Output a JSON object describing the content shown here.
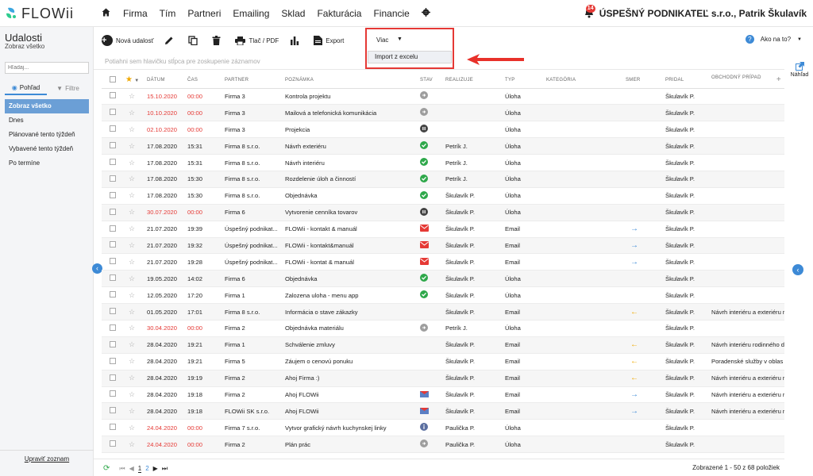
{
  "app": {
    "name": "FLOWii",
    "company": "ÚSPEŠNÝ PODNIKATEĽ s.r.o., Patrik Škulavík",
    "notifications": "14"
  },
  "nav": [
    "Firma",
    "Tím",
    "Partneri",
    "Emailing",
    "Sklad",
    "Fakturácia",
    "Financie"
  ],
  "sidebar": {
    "title": "Udalosti",
    "subtitle": "Zobraz všetko",
    "search_placeholder": "Hľadaj...",
    "tab_view": "Pohľad",
    "tab_filter": "Filtre",
    "items": [
      {
        "label": "Zobraz všetko",
        "active": true
      },
      {
        "label": "Dnes",
        "active": false
      },
      {
        "label": "Plánované tento týždeň",
        "active": false
      },
      {
        "label": "Vybavené tento týždeň",
        "active": false
      },
      {
        "label": "Po termíne",
        "active": false
      }
    ],
    "edit_list": "Upraviť zoznam"
  },
  "toolbar": {
    "new_event": "Nová udalosť",
    "print": "Tlač / PDF",
    "export": "Export",
    "more": "Viac",
    "import": "Import z excelu",
    "help": "Ako na to?",
    "preview": "Náhľad"
  },
  "group_hint": "Potiahni sem hlavičku stĺpca pre zoskupenie záznamov",
  "columns": [
    "DÁTUM",
    "ČAS",
    "PARTNER",
    "POZNÁMKA",
    "STAV",
    "REALIZUJE",
    "TYP",
    "KATEGÓRIA",
    "SMER",
    "PRIDAL",
    "OBCHODNÝ PRÍPAD"
  ],
  "rows": [
    {
      "date": "15.10.2020",
      "time": "00:00",
      "partner": "Firma 3",
      "note": "Kontrola projektu",
      "status": "pending",
      "assignee": "",
      "type": "Úloha",
      "direction": "",
      "added_by": "Škulavík P.",
      "case": "",
      "overdue": true
    },
    {
      "date": "10.10.2020",
      "time": "00:00",
      "partner": "Firma 3",
      "note": "Mailová a telefonická komunikácia",
      "status": "pending",
      "assignee": "",
      "type": "Úloha",
      "direction": "",
      "added_by": "Škulavík P.",
      "case": "",
      "overdue": true
    },
    {
      "date": "02.10.2020",
      "time": "00:00",
      "partner": "Firma 3",
      "note": "Projekcia",
      "status": "paused",
      "assignee": "",
      "type": "Úloha",
      "direction": "",
      "added_by": "Škulavík P.",
      "case": "",
      "overdue": true
    },
    {
      "date": "17.08.2020",
      "time": "15:31",
      "partner": "Firma 8 s.r.o.",
      "note": "Návrh exteriéru",
      "status": "done",
      "assignee": "Petrík J.",
      "type": "Úloha",
      "direction": "",
      "added_by": "Škulavík P.",
      "case": "",
      "overdue": false
    },
    {
      "date": "17.08.2020",
      "time": "15:31",
      "partner": "Firma 8 s.r.o.",
      "note": "Návrh interiéru",
      "status": "done",
      "assignee": "Petrík J.",
      "type": "Úloha",
      "direction": "",
      "added_by": "Škulavík P.",
      "case": "",
      "overdue": false
    },
    {
      "date": "17.08.2020",
      "time": "15:30",
      "partner": "Firma 8 s.r.o.",
      "note": "Rozdelenie úloh a činností",
      "status": "done",
      "assignee": "Petrík J.",
      "type": "Úloha",
      "direction": "",
      "added_by": "Škulavík P.",
      "case": "",
      "overdue": false
    },
    {
      "date": "17.08.2020",
      "time": "15:30",
      "partner": "Firma 8 s.r.o.",
      "note": "Objednávka",
      "status": "done",
      "assignee": "Škulavík P.",
      "type": "Úloha",
      "direction": "",
      "added_by": "Škulavík P.",
      "case": "",
      "overdue": false
    },
    {
      "date": "30.07.2020",
      "time": "00:00",
      "partner": "Firma 6",
      "note": "Vytvorenie cenníka tovarov",
      "status": "paused",
      "assignee": "Škulavík P.",
      "type": "Úloha",
      "direction": "",
      "added_by": "Škulavík P.",
      "case": "",
      "overdue": true
    },
    {
      "date": "21.07.2020",
      "time": "19:39",
      "partner": "Úspešný podnikat...",
      "note": "FLOWii - kontakt & manuál",
      "status": "email",
      "assignee": "Škulavík P.",
      "type": "Email",
      "direction": "out",
      "added_by": "Škulavík P.",
      "case": "",
      "overdue": false
    },
    {
      "date": "21.07.2020",
      "time": "19:32",
      "partner": "Úspešný podnikat...",
      "note": "FLOWii - kontakt&manuál",
      "status": "email",
      "assignee": "Škulavík P.",
      "type": "Email",
      "direction": "out",
      "added_by": "Škulavík P.",
      "case": "",
      "overdue": false
    },
    {
      "date": "21.07.2020",
      "time": "19:28",
      "partner": "Úspešný podnikat...",
      "note": "FLOWii - kontat & manuál",
      "status": "email",
      "assignee": "Škulavík P.",
      "type": "Email",
      "direction": "out",
      "added_by": "Škulavík P.",
      "case": "",
      "overdue": false
    },
    {
      "date": "19.05.2020",
      "time": "14:02",
      "partner": "Firma 6",
      "note": "Objednávka",
      "status": "done",
      "assignee": "Škulavík P.",
      "type": "Úloha",
      "direction": "",
      "added_by": "Škulavík P.",
      "case": "",
      "overdue": false
    },
    {
      "date": "12.05.2020",
      "time": "17:20",
      "partner": "Firma 1",
      "note": "Zalozena uloha - menu app",
      "status": "done",
      "assignee": "Škulavík P.",
      "type": "Úloha",
      "direction": "",
      "added_by": "Škulavík P.",
      "case": "",
      "overdue": false
    },
    {
      "date": "01.05.2020",
      "time": "17:01",
      "partner": "Firma 8 s.r.o.",
      "note": "Informácia o stave zákazky",
      "status": "",
      "assignee": "Škulavík P.",
      "type": "Email",
      "direction": "in",
      "added_by": "Škulavík P.",
      "case": "Návrh interiéru a exteriéru r",
      "overdue": false
    },
    {
      "date": "30.04.2020",
      "time": "00:00",
      "partner": "Firma 2",
      "note": "Objednávka materiálu",
      "status": "pending",
      "assignee": "Petrík J.",
      "type": "Úloha",
      "direction": "",
      "added_by": "Škulavík P.",
      "case": "",
      "overdue": true
    },
    {
      "date": "28.04.2020",
      "time": "19:21",
      "partner": "Firma 1",
      "note": "Schválenie zmluvy",
      "status": "",
      "assignee": "Škulavík P.",
      "type": "Email",
      "direction": "in",
      "added_by": "Škulavík P.",
      "case": "Návrh interiéru rodinného d",
      "overdue": false
    },
    {
      "date": "28.04.2020",
      "time": "19:21",
      "partner": "Firma 5",
      "note": "Záujem o cenovú ponuku",
      "status": "",
      "assignee": "Škulavík P.",
      "type": "Email",
      "direction": "in",
      "added_by": "Škulavík P.",
      "case": "Poradenské služby v oblas",
      "overdue": false
    },
    {
      "date": "28.04.2020",
      "time": "19:19",
      "partner": "Firma 2",
      "note": "Ahoj Firma :)",
      "status": "",
      "assignee": "Škulavík P.",
      "type": "Email",
      "direction": "in",
      "added_by": "Škulavík P.",
      "case": "Návrh interiéru a exteriéru r",
      "overdue": false
    },
    {
      "date": "28.04.2020",
      "time": "19:18",
      "partner": "Firma 2",
      "note": "Ahoj FLOWii",
      "status": "mail-open",
      "assignee": "Škulavík P.",
      "type": "Email",
      "direction": "out",
      "added_by": "Škulavík P.",
      "case": "Návrh interiéru a exteriéru r",
      "overdue": false
    },
    {
      "date": "28.04.2020",
      "time": "19:18",
      "partner": "FLOWii SK s.r.o.",
      "note": "Ahoj FLOWii",
      "status": "mail-open",
      "assignee": "Škulavík P.",
      "type": "Email",
      "direction": "out",
      "added_by": "Škulavík P.",
      "case": "Návrh interiéru a exteriéru r",
      "overdue": false
    },
    {
      "date": "24.04.2020",
      "time": "00:00",
      "partner": "Firma 7 s.r.o.",
      "note": "Vytvor grafický návrh kuchynskej linky",
      "status": "info",
      "assignee": "Paulička P.",
      "type": "Úloha",
      "direction": "",
      "added_by": "Škulavík P.",
      "case": "",
      "overdue": true
    },
    {
      "date": "24.04.2020",
      "time": "00:00",
      "partner": "Firma 2",
      "note": "Plán prác",
      "status": "pending",
      "assignee": "Paulička P.",
      "type": "Úloha",
      "direction": "",
      "added_by": "Škulavík P.",
      "case": "",
      "overdue": true
    }
  ],
  "footer": {
    "pages": [
      "1",
      "2"
    ],
    "summary": "Zobrazené 1 - 50 z 68 položiek"
  },
  "colors": {
    "accent": "#3d8ad6",
    "overdue": "#e53935",
    "done": "#2ea84a",
    "email": "#e53935",
    "arrow_out": "#3d8ad6",
    "arrow_in": "#f0a800"
  }
}
